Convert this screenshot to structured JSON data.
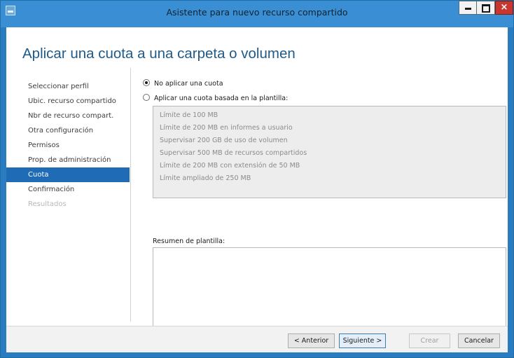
{
  "window": {
    "title": "Asistente para nuevo recurso compartido",
    "controls": {
      "minimize": "minimize-icon",
      "maximize": "maximize-icon",
      "close": "×"
    }
  },
  "page": {
    "heading": "Aplicar una cuota a una carpeta o volumen"
  },
  "nav": {
    "items": [
      {
        "label": "Seleccionar perfil",
        "state": "normal"
      },
      {
        "label": "Ubic. recurso compartido",
        "state": "normal"
      },
      {
        "label": "Nbr de recurso compart.",
        "state": "normal"
      },
      {
        "label": "Otra configuración",
        "state": "normal"
      },
      {
        "label": "Permisos",
        "state": "normal"
      },
      {
        "label": "Prop. de administración",
        "state": "normal"
      },
      {
        "label": "Cuota",
        "state": "selected"
      },
      {
        "label": "Confirmación",
        "state": "normal"
      },
      {
        "label": "Resultados",
        "state": "disabled"
      }
    ]
  },
  "quota": {
    "option_none": {
      "label": "No aplicar una cuota",
      "checked": true
    },
    "option_template": {
      "label": "Aplicar una cuota basada en la plantilla:",
      "checked": false
    },
    "templates": [
      "Límite de 100 MB",
      "Límite de 200 MB en informes a usuario",
      "Supervisar 200 GB de uso de volumen",
      "Supervisar 500 MB de recursos compartidos",
      "Límite de 200 MB con extensión de 50 MB",
      "Límite ampliado de 250 MB"
    ],
    "summary_label": "Resumen de plantilla:",
    "summary_text": ""
  },
  "footer": {
    "back": "< Anterior",
    "next": "Siguiente >",
    "create": "Crear",
    "cancel": "Cancelar"
  },
  "colors": {
    "titlebar": "#3a8fd4",
    "accent": "#1f6bb5",
    "heading": "#1e5a8a",
    "close": "#c7372f"
  }
}
